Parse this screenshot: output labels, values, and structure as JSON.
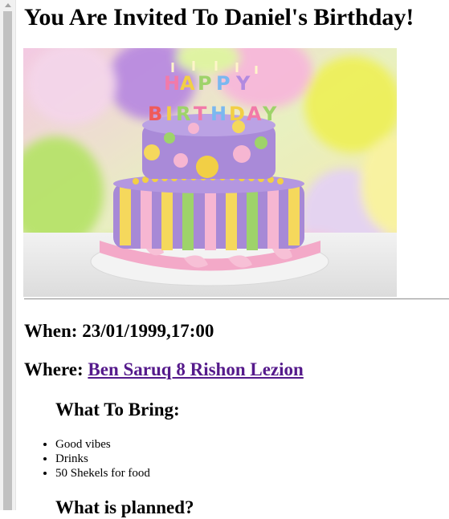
{
  "page": {
    "title": "You Are Invited To Daniel's Birthday!",
    "hero_image": {
      "alt": "Happy Birthday cake",
      "cake_topper_letters": [
        "H",
        "A",
        "P",
        "P",
        "Y",
        "B",
        "I",
        "R",
        "T",
        "H",
        "D",
        "A",
        "Y"
      ]
    },
    "when": {
      "text": "When: 23/01/1999,17:00"
    },
    "where": {
      "label": "Where: ",
      "link_text": "Ben Saruq 8 Rishon Lezion"
    },
    "what_to_bring": {
      "title": "What To Bring:",
      "items": [
        "Good vibes",
        "Drinks",
        "50 Shekels for food"
      ]
    },
    "what_is_planned": {
      "title": "What is planned?"
    }
  },
  "colors": {
    "link_visited": "#551a8b",
    "scrollbar_thumb": "#c1c1c1",
    "scrollbar_track": "#f1f1f1"
  }
}
